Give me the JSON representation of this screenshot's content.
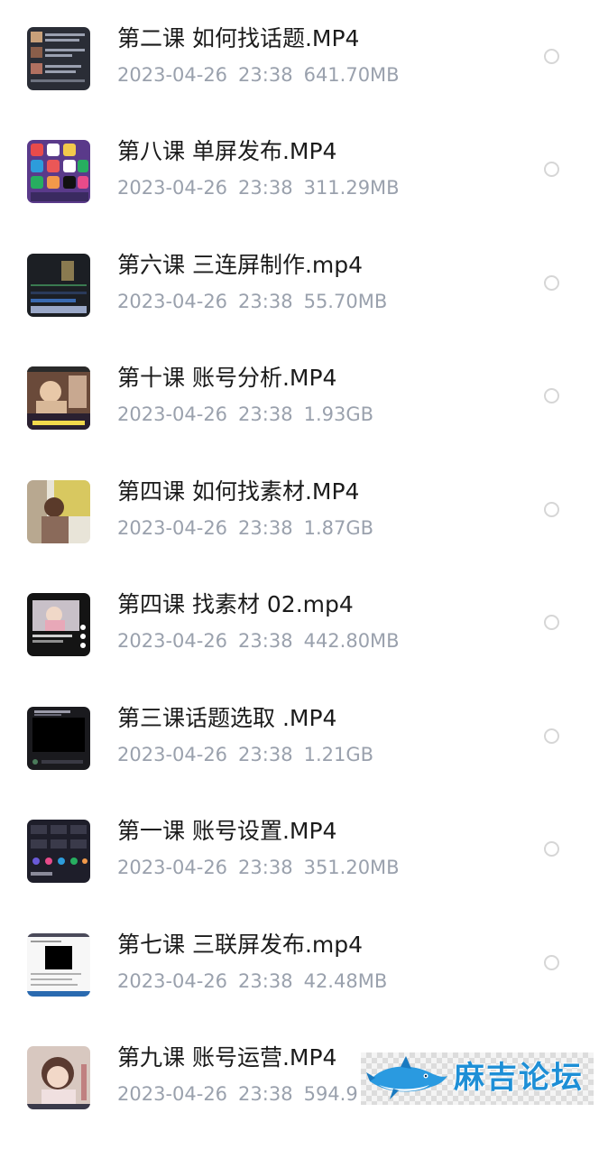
{
  "files": [
    {
      "name": "第二课 如何找话题.MP4",
      "date": "2023-04-26",
      "time": "23:38",
      "size": "641.70MB",
      "thumb": "chat-screenshot"
    },
    {
      "name": "第八课 单屏发布.MP4",
      "date": "2023-04-26",
      "time": "23:38",
      "size": "311.29MB",
      "thumb": "app-grid"
    },
    {
      "name": "第六课 三连屏制作.mp4",
      "date": "2023-04-26",
      "time": "23:38",
      "size": "55.70MB",
      "thumb": "video-editor"
    },
    {
      "name": "第十课 账号分析.MP4",
      "date": "2023-04-26",
      "time": "23:38",
      "size": "1.93GB",
      "thumb": "person-video"
    },
    {
      "name": "第四课 如何找素材.MP4",
      "date": "2023-04-26",
      "time": "23:38",
      "size": "1.87GB",
      "thumb": "child-photo"
    },
    {
      "name": "第四课 找素材 02.mp4",
      "date": "2023-04-26",
      "time": "23:38",
      "size": "442.80MB",
      "thumb": "dark-video"
    },
    {
      "name": "第三课话题选取 .MP4",
      "date": "2023-04-26",
      "time": "23:38",
      "size": "1.21GB",
      "thumb": "black-screen"
    },
    {
      "name": "第一课 账号设置.MP4",
      "date": "2023-04-26",
      "time": "23:38",
      "size": "351.20MB",
      "thumb": "stats-dashboard"
    },
    {
      "name": "第七课 三联屏发布.mp4",
      "date": "2023-04-26",
      "time": "23:38",
      "size": "42.48MB",
      "thumb": "document-page"
    },
    {
      "name": "第九课 账号运营.MP4",
      "date": "2023-04-26",
      "time": "23:38",
      "size": "594.9",
      "thumb": "portrait"
    }
  ],
  "watermark": {
    "text": "麻吉论坛",
    "color": "#1e8fd6"
  },
  "colors": {
    "name": "#1b1b1b",
    "meta": "#9aa1ad",
    "radio": "#d6d6d6"
  }
}
